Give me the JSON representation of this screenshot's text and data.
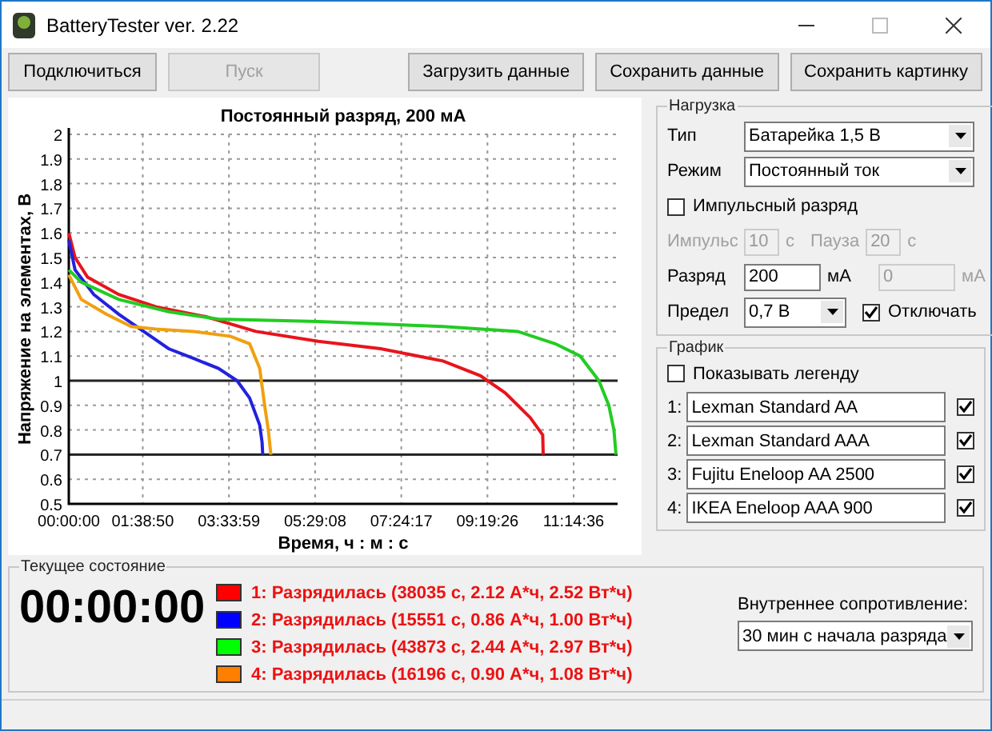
{
  "window": {
    "title": "BatteryTester ver. 2.22"
  },
  "toolbar": [
    {
      "label": "Подключиться",
      "disabled": false
    },
    {
      "label": "Пуск",
      "disabled": true
    },
    {
      "label": "Загрузить данные",
      "disabled": false
    },
    {
      "label": "Сохранить данные",
      "disabled": false
    },
    {
      "label": "Сохранить картинку",
      "disabled": false
    }
  ],
  "chart": {
    "chart_data": {
      "type": "line",
      "title": "Постоянный разряд, 200 мА",
      "xlabel": "Время, ч : м : с",
      "ylabel": "Напряжение на элементах, В",
      "xlim": [
        0,
        44000
      ],
      "ylim": [
        0.5,
        2
      ],
      "xticks": [
        {
          "value": 0,
          "label": "00:00:00"
        },
        {
          "value": 5930,
          "label": "01:38:50"
        },
        {
          "value": 12839,
          "label": "03:33:59"
        },
        {
          "value": 19748,
          "label": "05:29:08"
        },
        {
          "value": 26657,
          "label": "07:24:17"
        },
        {
          "value": 33566,
          "label": "09:19:26"
        },
        {
          "value": 40476,
          "label": "11:14:36"
        }
      ],
      "yticks": [
        0.5,
        0.6,
        0.7,
        0.8,
        0.9,
        1,
        1.1,
        1.2,
        1.3,
        1.4,
        1.5,
        1.6,
        1.7,
        1.8,
        1.9,
        2
      ],
      "grid": true,
      "ref_lines": [
        {
          "axis": "y",
          "value": 1
        },
        {
          "axis": "y",
          "value": 0.7
        }
      ],
      "series": [
        {
          "color": "#e8141c",
          "x": [
            0,
            500,
            1500,
            4000,
            7000,
            11000,
            15000,
            20000,
            25000,
            30000,
            33000,
            35000,
            37000,
            38000,
            38035
          ],
          "values": [
            1.6,
            1.5,
            1.42,
            1.35,
            1.3,
            1.26,
            1.2,
            1.16,
            1.13,
            1.08,
            1.02,
            0.95,
            0.85,
            0.78,
            0.7
          ]
        },
        {
          "color": "#2222dd",
          "x": [
            0,
            500,
            2000,
            4000,
            6000,
            8000,
            10000,
            12000,
            13500,
            14500,
            15300,
            15500,
            15551
          ],
          "values": [
            1.57,
            1.45,
            1.35,
            1.27,
            1.2,
            1.13,
            1.09,
            1.05,
            1,
            0.93,
            0.82,
            0.75,
            0.7
          ]
        },
        {
          "color": "#22cc22",
          "x": [
            0,
            1000,
            4000,
            8000,
            12000,
            20000,
            30000,
            36000,
            39000,
            41000,
            42500,
            43300,
            43700,
            43873
          ],
          "values": [
            1.45,
            1.4,
            1.33,
            1.28,
            1.25,
            1.24,
            1.22,
            1.2,
            1.15,
            1.1,
            1,
            0.9,
            0.8,
            0.7
          ]
        },
        {
          "color": "#f0a010",
          "x": [
            0,
            1000,
            3000,
            5000,
            7000,
            10000,
            13000,
            14500,
            15300,
            15700,
            16000,
            16196
          ],
          "values": [
            1.43,
            1.33,
            1.27,
            1.22,
            1.21,
            1.2,
            1.18,
            1.15,
            1.05,
            0.9,
            0.8,
            0.7
          ]
        }
      ]
    }
  },
  "load_group": {
    "title": "Нагрузка",
    "fields": [
      {
        "kind": "select",
        "label": "Тип",
        "value": "Батарейка 1,5 В"
      },
      {
        "kind": "select",
        "label": "Режим",
        "value": "Постоянный ток"
      }
    ],
    "pulse_checkbox": {
      "label": "Импульсный разряд",
      "checked": false
    },
    "pulse": {
      "label": "Импульс",
      "value": "10",
      "unit": "с",
      "disabled": true
    },
    "pause": {
      "label": "Пауза",
      "value": "20",
      "unit": "с",
      "disabled": true
    },
    "discharge": {
      "label": "Разряд",
      "value": "200",
      "unit": "мА",
      "disabled": false
    },
    "discharge_2": {
      "value": "0",
      "unit": "мА",
      "disabled": true
    },
    "limit": {
      "label": "Предел",
      "value": "0,7 В"
    },
    "cutoff_checkbox": {
      "label": "Отключать",
      "checked": true
    }
  },
  "graph_group": {
    "title": "График",
    "legend_checkbox": {
      "label": "Показывать легенду",
      "checked": false
    },
    "series": [
      {
        "index": "1:",
        "name": "Lexman Standard AA",
        "visible": true
      },
      {
        "index": "2:",
        "name": "Lexman Standard AAA",
        "visible": true
      },
      {
        "index": "3:",
        "name": "Fujitu Eneloop AA 2500",
        "visible": true
      },
      {
        "index": "4:",
        "name": "IKEA Eneloop AAA 900",
        "visible": true
      }
    ]
  },
  "status_group": {
    "title": "Текущее состояние",
    "time": "00:00:00",
    "results": [
      {
        "text": "1: Разрядилась (38035 с, 2.12 А*ч, 2.52 Вт*ч)",
        "color": "#ff0000"
      },
      {
        "text": "2: Разрядилась (15551 с, 0.86 А*ч, 1.00 Вт*ч)",
        "color": "#0000ff"
      },
      {
        "text": "3: Разрядилась (43873 с, 2.44 А*ч, 2.97 Вт*ч)",
        "color": "#00ff00"
      },
      {
        "text": "4: Разрядилась (16196 с, 0.90 А*ч, 1.08 Вт*ч)",
        "color": "#ff8000"
      }
    ],
    "resistance": {
      "label": "Внутреннее сопротивление:",
      "value": "30 мин с начала разряда"
    }
  }
}
